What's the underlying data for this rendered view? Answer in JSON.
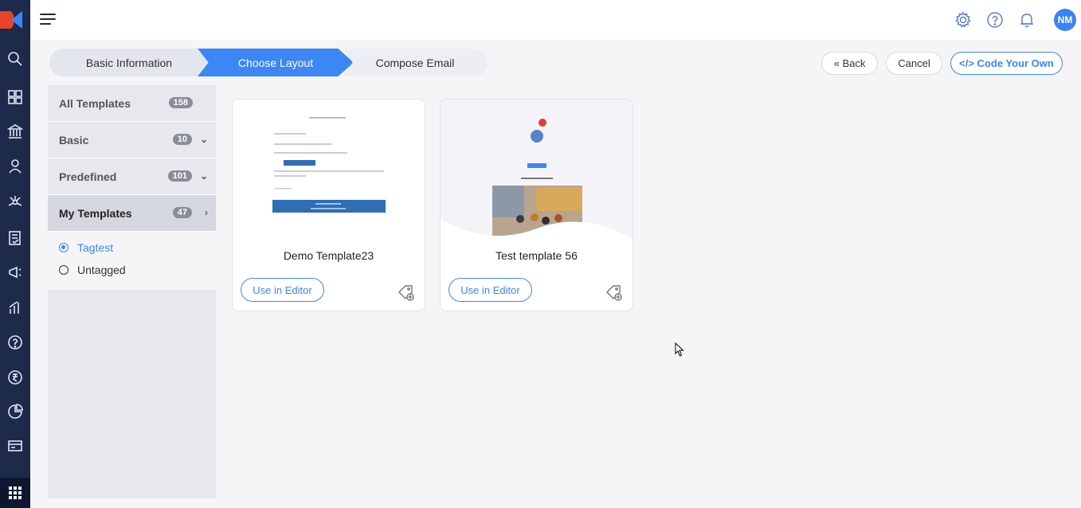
{
  "header": {
    "avatar_initials": "NM"
  },
  "stepper": {
    "steps": [
      {
        "label": "Basic Information"
      },
      {
        "label": "Choose Layout"
      },
      {
        "label": "Compose Email"
      }
    ]
  },
  "actions": {
    "back_label": "« Back",
    "cancel_label": "Cancel",
    "code_label": "</> Code Your Own"
  },
  "sidebar": {
    "items": [
      {
        "label": "All Templates",
        "count": "158"
      },
      {
        "label": "Basic",
        "count": "10"
      },
      {
        "label": "Predefined",
        "count": "101"
      },
      {
        "label": "My Templates",
        "count": "47"
      }
    ],
    "sub_items": [
      {
        "label": "Tagtest",
        "selected": true
      },
      {
        "label": "Untagged",
        "selected": false
      }
    ]
  },
  "templates": [
    {
      "name": "Demo Template23",
      "button": "Use in Editor"
    },
    {
      "name": "Test template 56",
      "button": "Use in Editor"
    }
  ],
  "colors": {
    "accent": "#3d86f5",
    "rail": "#1e2a4a"
  }
}
